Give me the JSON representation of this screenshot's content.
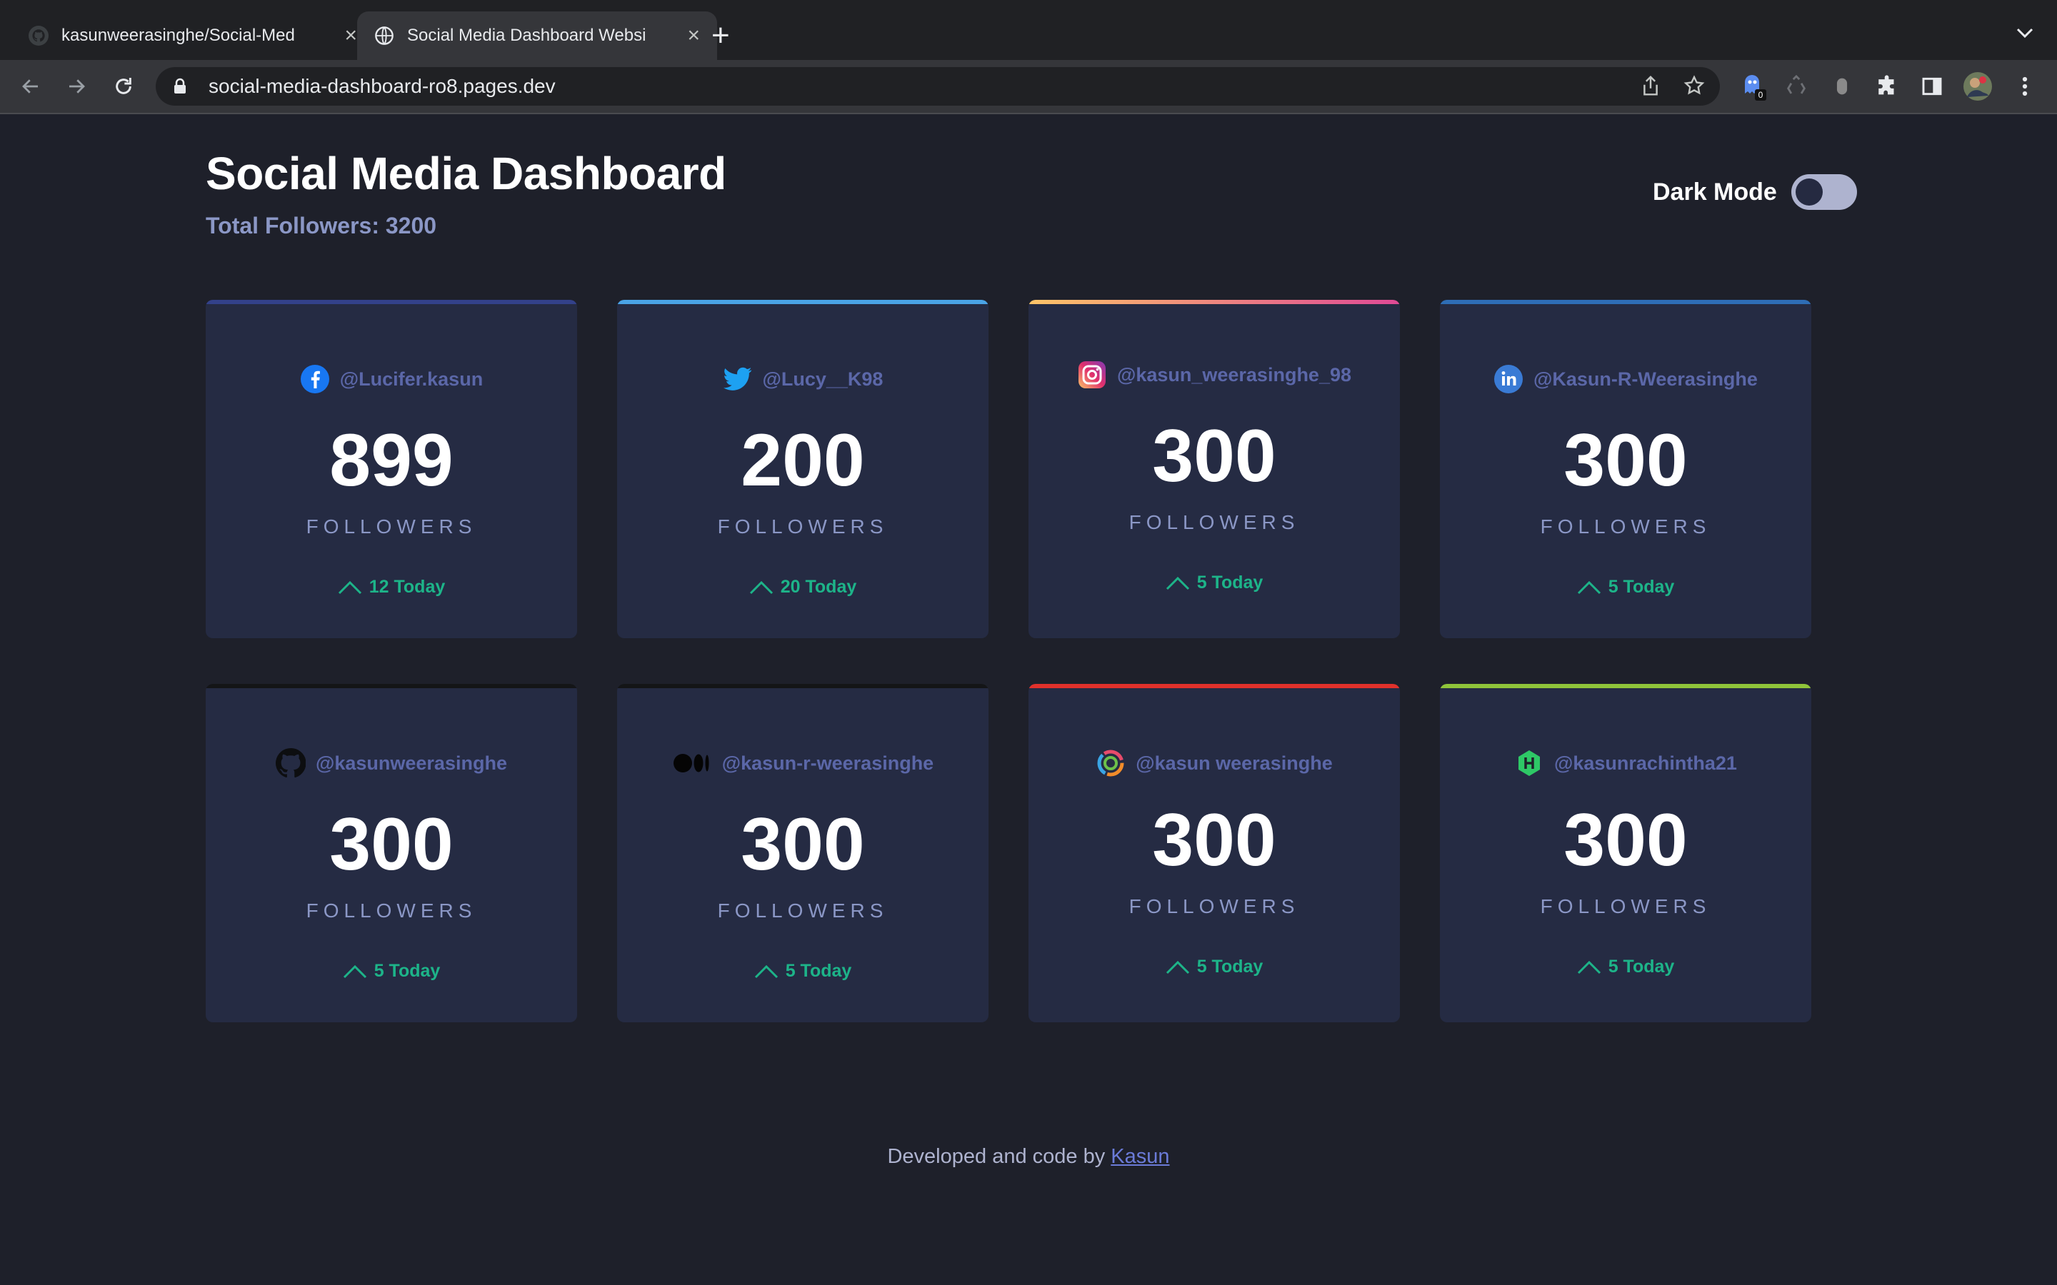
{
  "browser": {
    "tabs": [
      {
        "title": "kasunweerasinghe/Social-Med",
        "active": false,
        "favicon": "github-icon"
      },
      {
        "title": "Social Media Dashboard Websi",
        "active": true,
        "favicon": "globe-icon"
      }
    ],
    "url": "social-media-dashboard-ro8.pages.dev",
    "extension_badge": "0"
  },
  "page": {
    "title": "Social Media Dashboard",
    "total_followers": "Total Followers: 3200",
    "dark_mode_label": "Dark Mode"
  },
  "cards": [
    {
      "network": "facebook",
      "icon": "facebook-icon",
      "handle": "@Lucifer.kasun",
      "count": "899",
      "unit": "FOLLOWERS",
      "today": "12 Today",
      "color": "#1877f2"
    },
    {
      "network": "twitter",
      "icon": "twitter-icon",
      "handle": "@Lucy__K98",
      "count": "200",
      "unit": "FOLLOWERS",
      "today": "20 Today",
      "color": "#1da1f2"
    },
    {
      "network": "instagram",
      "icon": "instagram-icon",
      "handle": "@kasun_weerasinghe_98",
      "count": "300",
      "unit": "FOLLOWERS",
      "today": "5 Today",
      "color": "#df4996"
    },
    {
      "network": "linkedin",
      "icon": "linkedin-icon",
      "handle": "@Kasun-R-Weerasinghe",
      "count": "300",
      "unit": "FOLLOWERS",
      "today": "5 Today",
      "color": "#0a66c2"
    },
    {
      "network": "github",
      "icon": "github-icon",
      "handle": "@kasunweerasinghe",
      "count": "300",
      "unit": "FOLLOWERS",
      "today": "5 Today",
      "color": "#111111"
    },
    {
      "network": "medium",
      "icon": "medium-icon",
      "handle": "@kasun-r-weerasinghe",
      "count": "300",
      "unit": "FOLLOWERS",
      "today": "5 Today",
      "color": "#111111"
    },
    {
      "network": "sololearn",
      "icon": "sololearn-icon",
      "handle": "@kasun weerasinghe",
      "count": "300",
      "unit": "FOLLOWERS",
      "today": "5 Today",
      "color": "#e0312b"
    },
    {
      "network": "hackerrank",
      "icon": "hackerrank-icon",
      "handle": "@kasunrachintha21",
      "count": "300",
      "unit": "FOLLOWERS",
      "today": "5 Today",
      "color": "#8fc43a"
    }
  ],
  "footer": {
    "text": "Developed and code by",
    "link": "Kasun"
  },
  "colors": {
    "background": "#1e202a",
    "card": "#252b43",
    "up": "#1db489",
    "muted": "#8b97c6"
  }
}
